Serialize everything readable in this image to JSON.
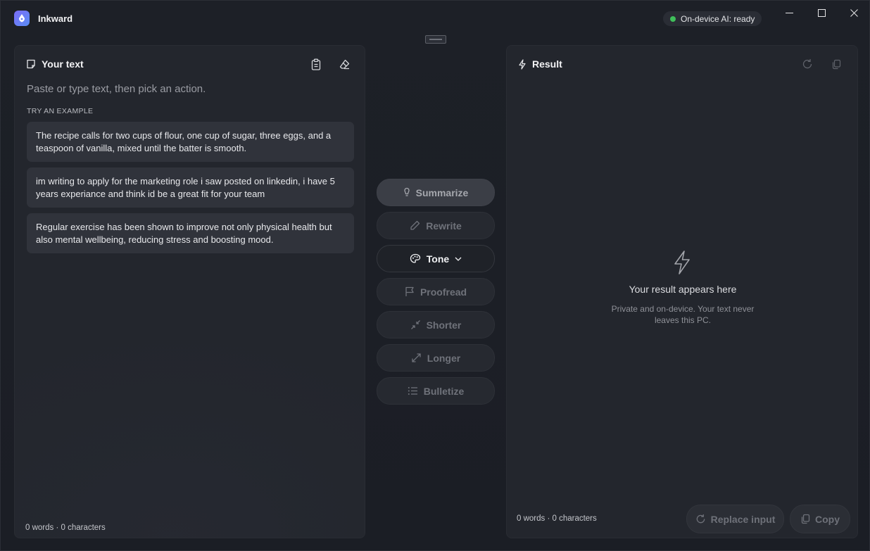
{
  "app": {
    "title": "Inkward"
  },
  "status": {
    "label": "On-device AI: ready",
    "color": "#3fbf5a"
  },
  "input_panel": {
    "title": "Your text",
    "placeholder": "Paste or type text, then pick an action.",
    "examples_label": "TRY AN EXAMPLE",
    "examples": [
      "The recipe calls for two cups of flour, one cup of sugar, three eggs, and a teaspoon of vanilla, mixed until the batter is smooth.",
      "im writing to apply for the marketing role i saw posted on linkedin, i have 5 years experiance and think id be a great fit for your team",
      "Regular exercise has been shown to improve not only physical health but also mental wellbeing, reducing stress and boosting mood."
    ],
    "count": "0 words · 0 characters"
  },
  "actions": {
    "summarize": "Summarize",
    "rewrite": "Rewrite",
    "tone": "Tone",
    "proofread": "Proofread",
    "shorter": "Shorter",
    "longer": "Longer",
    "bulletize": "Bulletize"
  },
  "result_panel": {
    "title": "Result",
    "empty_title": "Your result appears here",
    "empty_subtitle": "Private and on-device. Your text never leaves this PC.",
    "count": "0 words · 0 characters",
    "replace_label": "Replace input",
    "copy_label": "Copy"
  }
}
